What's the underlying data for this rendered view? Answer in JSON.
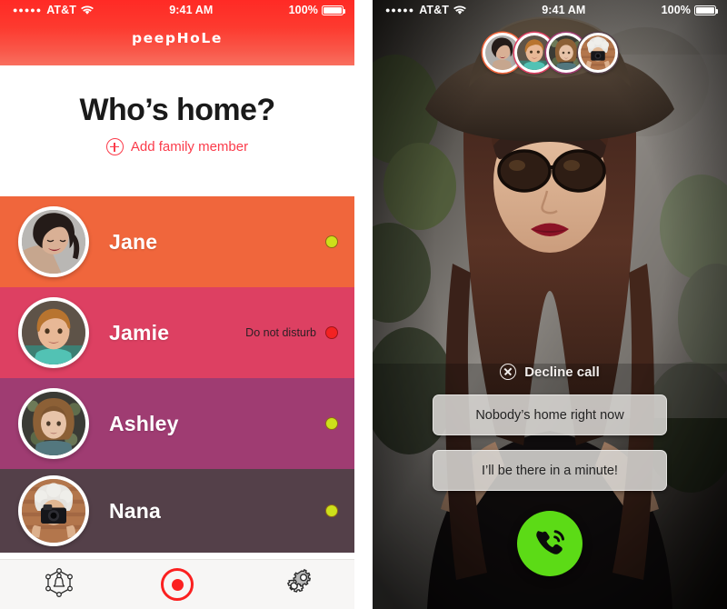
{
  "left_screen": {
    "status_bar": {
      "signal_dots": "●●●●●",
      "carrier": "AT&T",
      "wifi_icon": "wifi-icon",
      "time": "9:41 AM",
      "battery_percent": "100%",
      "battery_icon": "battery-full-icon"
    },
    "brand": "peepHoLe",
    "page_title": "Who’s home?",
    "add_member": {
      "label": "Add family member",
      "icon": "plus-circle-icon",
      "color": "#fb3b4a"
    },
    "members": [
      {
        "name": "Jane",
        "row_color": "#f0663c",
        "status_label": "",
        "status_color": "#cde01a",
        "status_name": "available"
      },
      {
        "name": "Jamie",
        "row_color": "#dd4062",
        "status_label": "Do not disturb",
        "status_color": "#f32222",
        "status_name": "do-not-disturb"
      },
      {
        "name": "Ashley",
        "row_color": "#9f3c72",
        "status_label": "",
        "status_color": "#cde01a",
        "status_name": "available"
      },
      {
        "name": "Nana",
        "row_color": "#544049",
        "status_label": "",
        "status_color": "#cde01a",
        "status_name": "available"
      }
    ],
    "tabbar": [
      {
        "icon": "family-network-icon",
        "label": ""
      },
      {
        "icon": "record-button-icon",
        "label": ""
      },
      {
        "icon": "gears-settings-icon",
        "label": ""
      }
    ]
  },
  "right_screen": {
    "status_bar": {
      "signal_dots": "●●●●●",
      "carrier": "AT&T",
      "wifi_icon": "wifi-icon",
      "time": "9:41 AM",
      "battery_percent": "100%",
      "battery_icon": "battery-full-icon"
    },
    "avatar_strip": [
      {
        "name": "Jane",
        "ring_color": "#f0663c"
      },
      {
        "name": "Jamie",
        "ring_color": "#dd4062"
      },
      {
        "name": "Ashley",
        "ring_color": "#9f3c72"
      },
      {
        "name": "Nana",
        "ring_color": "#544049"
      }
    ],
    "decline": {
      "label": "Decline call",
      "icon": "x-circle-icon"
    },
    "quick_replies": [
      "Nobody’s home right now",
      "I’ll be there in a minute!"
    ],
    "answer_button": {
      "icon": "phone-handset-icon",
      "color": "#5cdb16"
    },
    "video_description": "live-door-camera-feed"
  }
}
